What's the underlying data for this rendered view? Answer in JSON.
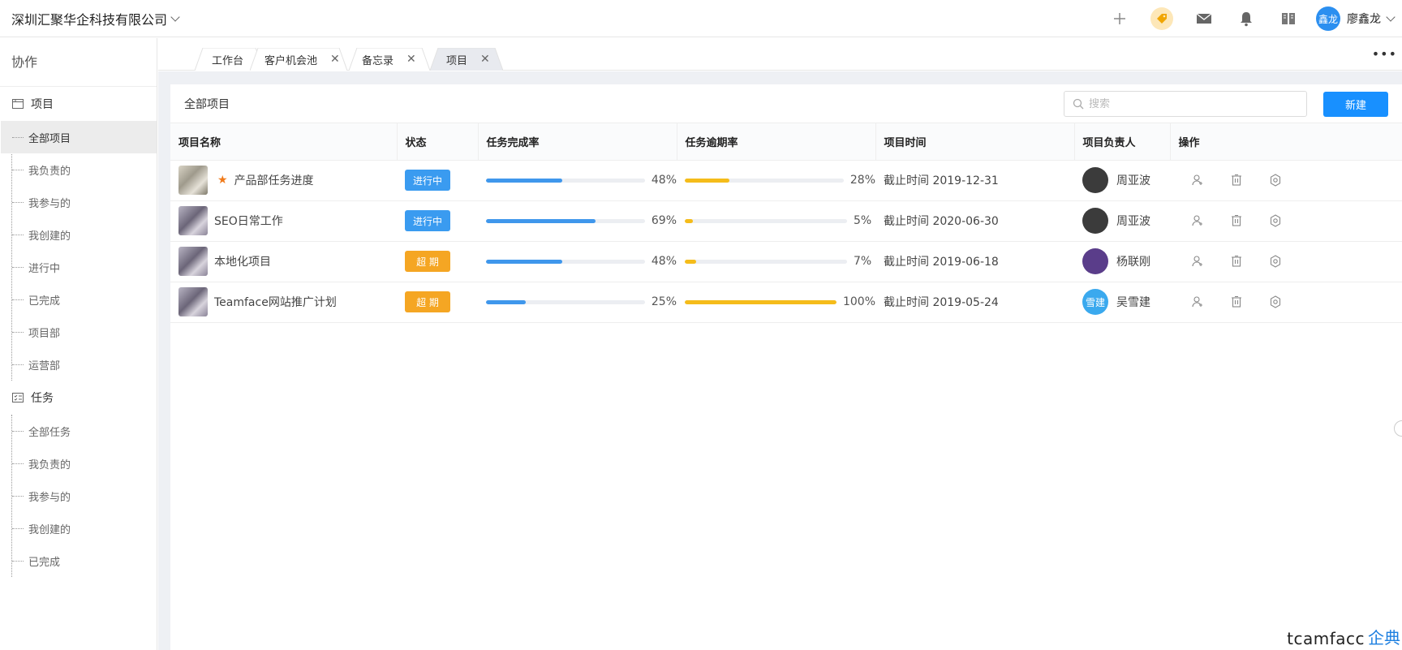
{
  "topbar": {
    "company": "深圳汇聚华企科技有限公司",
    "user_avatar_text": "鑫龙",
    "user_name": "廖鑫龙",
    "icons": [
      "plus-icon",
      "tag-icon",
      "mail-icon",
      "bell-icon",
      "book-icon"
    ],
    "tag_bg_color": "#fde7b8"
  },
  "sidebar": {
    "title": "协作",
    "groups": [
      {
        "label": "项目",
        "icon": "project-icon",
        "items": [
          "全部项目",
          "我负责的",
          "我参与的",
          "我创建的",
          "进行中",
          "已完成",
          "项目部",
          "运营部"
        ],
        "active": 0
      },
      {
        "label": "任务",
        "icon": "task-list-icon",
        "items": [
          "全部任务",
          "我负责的",
          "我参与的",
          "我创建的",
          "已完成"
        ]
      }
    ]
  },
  "tabs": [
    {
      "label": "工作台",
      "closable": false
    },
    {
      "label": "客户机会池",
      "closable": true
    },
    {
      "label": "备忘录",
      "closable": true
    },
    {
      "label": "项目",
      "closable": true,
      "active": true
    }
  ],
  "panel": {
    "title": "全部项目",
    "search_placeholder": "搜索",
    "new_button": "新建"
  },
  "table": {
    "columns": [
      "项目名称",
      "状态",
      "任务完成率",
      "任务逾期率",
      "项目时间",
      "项目负责人",
      "操作"
    ],
    "rows": [
      {
        "name": "产品部任务进度",
        "starred": true,
        "status": "进行中",
        "status_color": "#3a9bf0",
        "done": 48,
        "done_label": "48%",
        "overdue": 28,
        "overdue_label": "28%",
        "time": "截止时间 2019-12-31",
        "owner": "周亚波",
        "owner_avatar": ""
      },
      {
        "name": "SEO日常工作",
        "starred": false,
        "status": "进行中",
        "status_color": "#3a9bf0",
        "done": 69,
        "done_label": "69%",
        "overdue": 5,
        "overdue_label": "5%",
        "time": "截止时间 2020-06-30",
        "owner": "周亚波",
        "owner_avatar": ""
      },
      {
        "name": "本地化项目",
        "starred": false,
        "status": "超 期",
        "status_color": "#f5a623",
        "done": 48,
        "done_label": "48%",
        "overdue": 7,
        "overdue_label": "7%",
        "time": "截止时间 2019-06-18",
        "owner": "杨联刚",
        "owner_avatar": ""
      },
      {
        "name": "Teamface网站推广计划",
        "starred": false,
        "status": "超 期",
        "status_color": "#f5a623",
        "done": 25,
        "done_label": "25%",
        "overdue": 100,
        "overdue_label": "100%",
        "time": "截止时间 2019-05-24",
        "owner": "吴雪建",
        "owner_avatar": "雪建"
      }
    ],
    "done_color": "#3f97ec",
    "overdue_color": "#f5bc1a",
    "ops_icons": [
      "user-add-icon",
      "delete-icon",
      "settings-icon"
    ]
  },
  "brand": {
    "en": "tcamfacc",
    "cn": "企典"
  }
}
